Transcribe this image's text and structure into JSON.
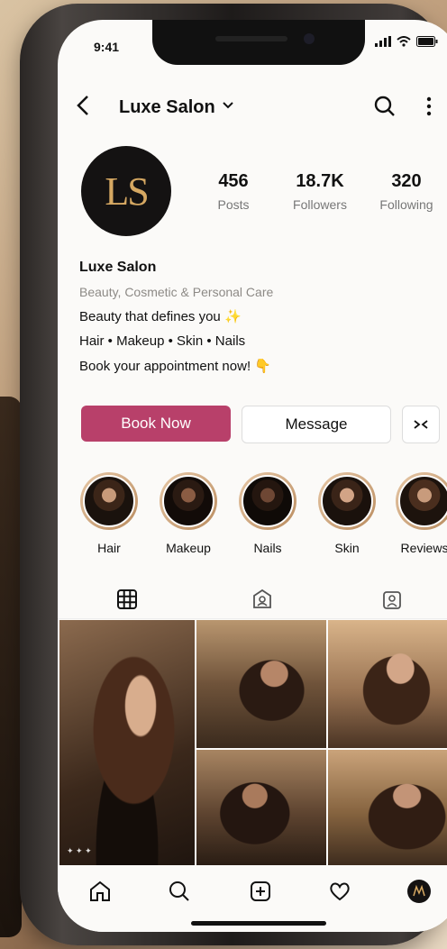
{
  "status_bar": {
    "time": "9:41"
  },
  "header": {
    "title": "Luxe Salon"
  },
  "profile": {
    "avatar_text": "LS",
    "stats": [
      {
        "value": "456",
        "label": "Posts"
      },
      {
        "value": "18.7K",
        "label": "Followers"
      },
      {
        "value": "320",
        "label": "Following"
      }
    ],
    "name": "Luxe Salon",
    "category": "Beauty, Cosmetic & Personal Care",
    "bio": [
      "Beauty that defines you ✨",
      "Hair • Makeup • Skin • Nails",
      "Book your appointment now! 👇"
    ]
  },
  "actions": {
    "book": "Book Now",
    "message": "Message",
    "more_icon": "expand-arrows-icon"
  },
  "highlights": [
    {
      "label": "Hair"
    },
    {
      "label": "Makeup"
    },
    {
      "label": "Nails"
    },
    {
      "label": "Skin"
    },
    {
      "label": "Reviews"
    }
  ],
  "tabs": [
    "grid-icon",
    "reels-icon",
    "tagged-icon"
  ],
  "navbar": [
    "home-icon",
    "search-icon",
    "add-icon",
    "heart-icon",
    "profile-icon"
  ],
  "colors": {
    "accent": "#b8406a",
    "gold": "#d6a862"
  }
}
